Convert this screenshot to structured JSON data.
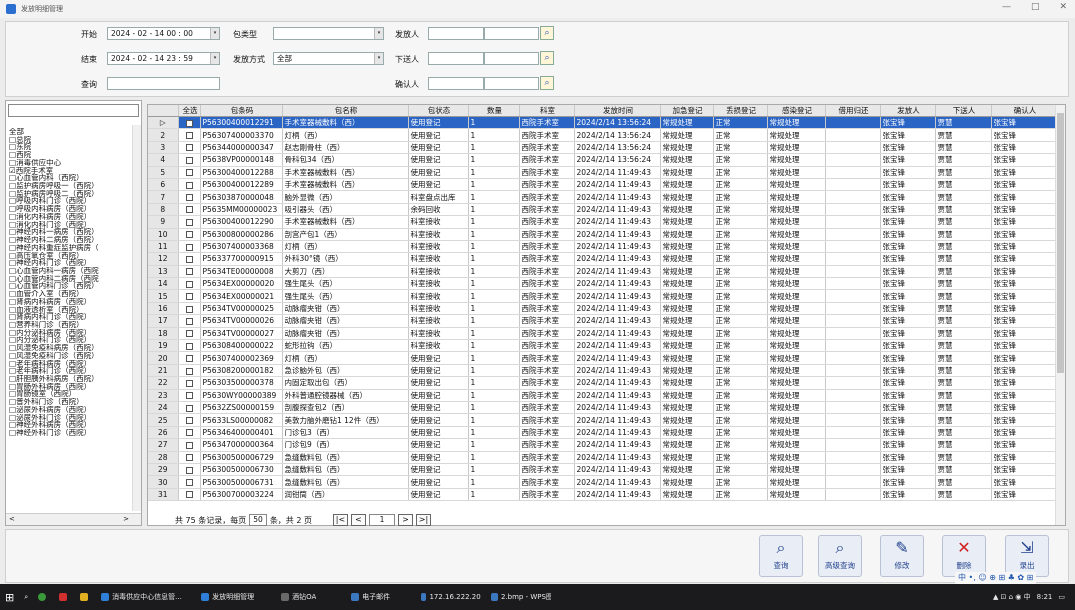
{
  "window": {
    "title": "发放明细管理",
    "min_label": "—",
    "max_label": "□",
    "close_label": "✕"
  },
  "filters": {
    "start_label": "开始",
    "start_value": "2024 - 02 - 14   00 : 00",
    "end_label": "结束",
    "end_value": "2024 - 02 - 14   23 : 59",
    "query_label": "查询",
    "query_value": "",
    "pkg_type_label": "包类型",
    "pkg_type_value": "",
    "issue_method_label": "发放方式",
    "issue_method_value": "全部",
    "issuer_label": "发放人",
    "deliverer_label": "下送人",
    "confirmer_label": "确认人"
  },
  "tree": {
    "items": [
      "全部",
      "□总院",
      "□东院",
      "□西院",
      "  □消毒供应中心",
      "  ☑西院手术室",
      "  □心血管内科（西院）",
      "  □监护病房呼吸一（西院）",
      "  □监护病房呼吸二（西院）",
      "  □呼吸内科门诊（西院）",
      "  □呼吸内科病房（西院）",
      "  □消化内科病房（西院）",
      "  □消化内科门诊（西院）",
      "  □神经内科一病房（西院）",
      "  □神经内科二病房（西院）",
      "  □神经内科重症监护病房（",
      "  □高压氧仓室（西院）",
      "  □神经内科门诊（西院）",
      "  □心血管内科一病房（西院",
      "  □心血管内科二病房（西院",
      "  □心血管内科门诊（西院）",
      "  □血管介入室（西院）",
      "  □肾病内科病房（西院）",
      "  □血液透析室（西院）",
      "  □肾病内科门诊（西院）",
      "  □营养科门诊（西院）",
      "  □内分泌科病房（西院）",
      "  □内分泌科门诊（西院）",
      "  □风湿免疫科病房（西院）",
      "  □风湿免疫科门诊（西院）",
      "  □老年病科病房（西院）",
      "  □老年病科门诊（西院）",
      "  □肝胆胰外科病房（西院）",
      "  □胃肠外科病房（西院）",
      "  □胃肠镜室（西院）",
      "  □普外科门诊（西院）",
      "  □泌尿外科病房（西院）",
      "  □泌尿外科门诊（西院）",
      "  □神经外科病房（西院）",
      "  □神经外科门诊（西院）"
    ],
    "scroll_left": "<",
    "scroll_right": ">"
  },
  "table": {
    "headers": [
      "",
      "全选",
      "包条码",
      "包名称",
      "包状态",
      "数量",
      "科室",
      "发放时间",
      "加急登记",
      "丢损登记",
      "感染登记",
      "借用归还",
      "发放人",
      "下送人",
      "确认人"
    ],
    "rows": [
      [
        "▷",
        "",
        "P56300400012291",
        "手术室器械敷料（西）",
        "使用登记",
        "1",
        "西院手术室",
        "2024/2/14 13:56:24",
        "常规处理",
        "正常",
        "常规处理",
        "",
        "张宝锋",
        "贾慧",
        "张宝锋"
      ],
      [
        "2",
        "",
        "P56307400003370",
        "灯柄（西）",
        "使用登记",
        "1",
        "西院手术室",
        "2024/2/14 13:56:24",
        "常规处理",
        "正常",
        "常规处理",
        "",
        "张宝锋",
        "贾慧",
        "张宝锋"
      ],
      [
        "3",
        "",
        "P56344000000347",
        "赵志刚骨柱（西）",
        "使用登记",
        "1",
        "西院手术室",
        "2024/2/14 13:56:24",
        "常规处理",
        "正常",
        "常规处理",
        "",
        "张宝锋",
        "贾慧",
        "张宝锋"
      ],
      [
        "4",
        "",
        "P5638VP00000148",
        "骨科包34（西）",
        "使用登记",
        "1",
        "西院手术室",
        "2024/2/14 13:56:24",
        "常规处理",
        "正常",
        "常规处理",
        "",
        "张宝锋",
        "贾慧",
        "张宝锋"
      ],
      [
        "5",
        "",
        "P56300400012288",
        "手术室器械敷料（西）",
        "使用登记",
        "1",
        "西院手术室",
        "2024/2/14 11:49:43",
        "常规处理",
        "正常",
        "常规处理",
        "",
        "张宝锋",
        "贾慧",
        "张宝锋"
      ],
      [
        "6",
        "",
        "P56300400012289",
        "手术室器械敷料（西）",
        "使用登记",
        "1",
        "西院手术室",
        "2024/2/14 11:49:43",
        "常规处理",
        "正常",
        "常规处理",
        "",
        "张宝锋",
        "贾慧",
        "张宝锋"
      ],
      [
        "7",
        "",
        "P56303870000048",
        "脑外显微（西）",
        "科室盘点出库",
        "1",
        "西院手术室",
        "2024/2/14 11:49:43",
        "常规处理",
        "正常",
        "常规处理",
        "",
        "张宝锋",
        "贾慧",
        "张宝锋"
      ],
      [
        "8",
        "",
        "P5635MM00000023",
        "吸引器头（西）",
        "余码回收",
        "1",
        "西院手术室",
        "2024/2/14 11:49:43",
        "常规处理",
        "正常",
        "常规处理",
        "",
        "张宝锋",
        "贾慧",
        "张宝锋"
      ],
      [
        "9",
        "",
        "P56300400012290",
        "手术室器械敷料（西）",
        "科室接收",
        "1",
        "西院手术室",
        "2024/2/14 11:49:43",
        "常规处理",
        "正常",
        "常规处理",
        "",
        "张宝锋",
        "贾慧",
        "张宝锋"
      ],
      [
        "10",
        "",
        "P56300800000286",
        "剖宫产包1（西）",
        "科室接收",
        "1",
        "西院手术室",
        "2024/2/14 11:49:43",
        "常规处理",
        "正常",
        "常规处理",
        "",
        "张宝锋",
        "贾慧",
        "张宝锋"
      ],
      [
        "11",
        "",
        "P56307400003368",
        "灯柄（西）",
        "科室接收",
        "1",
        "西院手术室",
        "2024/2/14 11:49:43",
        "常规处理",
        "正常",
        "常规处理",
        "",
        "张宝锋",
        "贾慧",
        "张宝锋"
      ],
      [
        "12",
        "",
        "P56337700000915",
        "外科30°镜（西）",
        "科室接收",
        "1",
        "西院手术室",
        "2024/2/14 11:49:43",
        "常规处理",
        "正常",
        "常规处理",
        "",
        "张宝锋",
        "贾慧",
        "张宝锋"
      ],
      [
        "13",
        "",
        "P5634TE00000008",
        "大剪刀（西）",
        "科室接收",
        "1",
        "西院手术室",
        "2024/2/14 11:49:43",
        "常规处理",
        "正常",
        "常规处理",
        "",
        "张宝锋",
        "贾慧",
        "张宝锋"
      ],
      [
        "14",
        "",
        "P5634EX00000020",
        "强生尾头（西）",
        "科室接收",
        "1",
        "西院手术室",
        "2024/2/14 11:49:43",
        "常规处理",
        "正常",
        "常规处理",
        "",
        "张宝锋",
        "贾慧",
        "张宝锋"
      ],
      [
        "15",
        "",
        "P5634EX00000021",
        "强生尾头（西）",
        "科室接收",
        "1",
        "西院手术室",
        "2024/2/14 11:49:43",
        "常规处理",
        "正常",
        "常规处理",
        "",
        "张宝锋",
        "贾慧",
        "张宝锋"
      ],
      [
        "16",
        "",
        "P5634TV00000025",
        "动脉瘤夹钳（西）",
        "科室接收",
        "1",
        "西院手术室",
        "2024/2/14 11:49:43",
        "常规处理",
        "正常",
        "常规处理",
        "",
        "张宝锋",
        "贾慧",
        "张宝锋"
      ],
      [
        "17",
        "",
        "P5634TV00000026",
        "动脉瘤夹钳（西）",
        "科室接收",
        "1",
        "西院手术室",
        "2024/2/14 11:49:43",
        "常规处理",
        "正常",
        "常规处理",
        "",
        "张宝锋",
        "贾慧",
        "张宝锋"
      ],
      [
        "18",
        "",
        "P5634TV00000027",
        "动脉瘤夹钳（西）",
        "科室接收",
        "1",
        "西院手术室",
        "2024/2/14 11:49:43",
        "常规处理",
        "正常",
        "常规处理",
        "",
        "张宝锋",
        "贾慧",
        "张宝锋"
      ],
      [
        "19",
        "",
        "P56308400000022",
        "蛇形拉钩（西）",
        "科室接收",
        "1",
        "西院手术室",
        "2024/2/14 11:49:43",
        "常规处理",
        "正常",
        "常规处理",
        "",
        "张宝锋",
        "贾慧",
        "张宝锋"
      ],
      [
        "20",
        "",
        "P56307400002369",
        "灯柄（西）",
        "使用登记",
        "1",
        "西院手术室",
        "2024/2/14 11:49:43",
        "常规处理",
        "正常",
        "常规处理",
        "",
        "张宝锋",
        "贾慧",
        "张宝锋"
      ],
      [
        "21",
        "",
        "P56308200000182",
        "急诊脑外包（西）",
        "使用登记",
        "1",
        "西院手术室",
        "2024/2/14 11:49:43",
        "常规处理",
        "正常",
        "常规处理",
        "",
        "张宝锋",
        "贾慧",
        "张宝锋"
      ],
      [
        "22",
        "",
        "P56303500000378",
        "内固定取出包（西）",
        "使用登记",
        "1",
        "西院手术室",
        "2024/2/14 11:49:43",
        "常规处理",
        "正常",
        "常规处理",
        "",
        "张宝锋",
        "贾慧",
        "张宝锋"
      ],
      [
        "23",
        "",
        "P5630WY00000389",
        "外科普通腔镜器械（西）",
        "使用登记",
        "1",
        "西院手术室",
        "2024/2/14 11:49:43",
        "常规处理",
        "正常",
        "常规处理",
        "",
        "张宝锋",
        "贾慧",
        "张宝锋"
      ],
      [
        "24",
        "",
        "P5632ZS00000159",
        "剖腹探查包2（西）",
        "使用登记",
        "1",
        "西院手术室",
        "2024/2/14 11:49:43",
        "常规处理",
        "正常",
        "常规处理",
        "",
        "张宝锋",
        "贾慧",
        "张宝锋"
      ],
      [
        "25",
        "",
        "P5633LS00000082",
        "美敦力脑外磨钻1 12件（西）",
        "使用登记",
        "1",
        "西院手术室",
        "2024/2/14 11:49:43",
        "常规处理",
        "正常",
        "常规处理",
        "",
        "张宝锋",
        "贾慧",
        "张宝锋"
      ],
      [
        "26",
        "",
        "P56346400000401",
        "门诊包3（西）",
        "使用登记",
        "1",
        "西院手术室",
        "2024/2/14 11:49:43",
        "常规处理",
        "正常",
        "常规处理",
        "",
        "张宝锋",
        "贾慧",
        "张宝锋"
      ],
      [
        "27",
        "",
        "P56347000000364",
        "门诊包9（西）",
        "使用登记",
        "1",
        "西院手术室",
        "2024/2/14 11:49:43",
        "常规处理",
        "正常",
        "常规处理",
        "",
        "张宝锋",
        "贾慧",
        "张宝锋"
      ],
      [
        "28",
        "",
        "P56300500006729",
        "急缝敷料包（西）",
        "使用登记",
        "1",
        "西院手术室",
        "2024/2/14 11:49:43",
        "常规处理",
        "正常",
        "常规处理",
        "",
        "张宝锋",
        "贾慧",
        "张宝锋"
      ],
      [
        "29",
        "",
        "P56300500006730",
        "急缝敷料包（西）",
        "使用登记",
        "1",
        "西院手术室",
        "2024/2/14 11:49:43",
        "常规处理",
        "正常",
        "常规处理",
        "",
        "张宝锋",
        "贾慧",
        "张宝锋"
      ],
      [
        "30",
        "",
        "P56300500006731",
        "急缝敷料包（西）",
        "使用登记",
        "1",
        "西院手术室",
        "2024/2/14 11:49:43",
        "常规处理",
        "正常",
        "常规处理",
        "",
        "张宝锋",
        "贾慧",
        "张宝锋"
      ],
      [
        "31",
        "",
        "P56300700003224",
        "润钳筒（西）",
        "使用登记",
        "1",
        "西院手术室",
        "2024/2/14 11:49:43",
        "常规处理",
        "正常",
        "常规处理",
        "",
        "张宝锋",
        "贾慧",
        "张宝锋"
      ]
    ]
  },
  "pager": {
    "total_text": "共 75 条记录，每页",
    "page_size": "50",
    "pages_text": "条，共 2 页",
    "first": "|<",
    "prev": "<",
    "page": "1",
    "next": ">",
    "last": ">|"
  },
  "actions": {
    "query": "查询",
    "advanced_query": "高级查询",
    "edit": "修改",
    "delete": "删除",
    "record": "录出"
  },
  "taskbar": {
    "items": [
      "消毒供应中心信息管...",
      "发放明细管理",
      "酒钻OA",
      "电子邮件",
      "172.16.222.200/gen...",
      "2.bmp - WPS图片"
    ],
    "clock": "8:21"
  },
  "ime": {
    "text": "中 •, ☺ ⊕ ⊞ ♣ ✿ ⊞"
  },
  "colors": {
    "selection": "#2a64c5"
  }
}
